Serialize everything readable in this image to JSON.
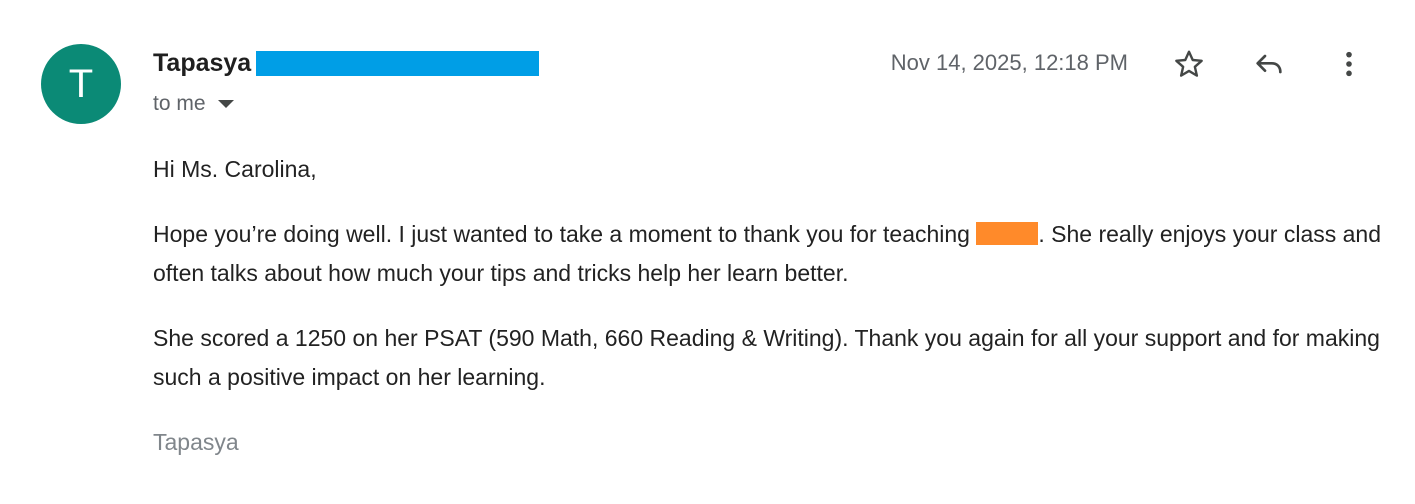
{
  "message": {
    "avatar_letter": "T",
    "sender_name": "Tapasya",
    "recipient": "to me",
    "timestamp": "Nov 14, 2025, 12:18 PM",
    "body": {
      "greeting": "Hi Ms. Carolina,",
      "para1_before": "Hope you’re doing well. I just wanted to take a moment to thank you for teaching ",
      "para1_after": ". She really enjoys your class and often talks about how much your tips and tricks help her learn better.",
      "para2": "She scored a 1250 on her PSAT (590 Math, 660 Reading & Writing). Thank you again for all your support and for making such a positive impact on her learning.",
      "signature": "Tapasya"
    }
  },
  "icons": {
    "star": "star-icon",
    "reply": "reply-icon",
    "more": "more-vert-icon",
    "caret": "chevron-down-icon"
  },
  "colors": {
    "avatar_bg": "#0b8a76",
    "email_redaction": "#009ee6",
    "name_redaction": "#ff8a2a",
    "muted_text": "#5f6368"
  }
}
